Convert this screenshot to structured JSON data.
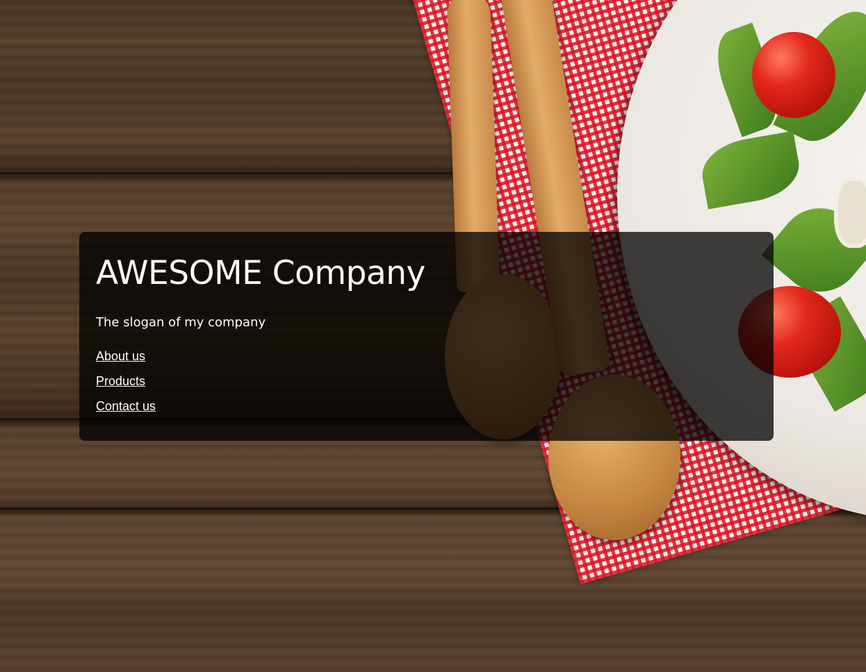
{
  "hero": {
    "title": "AWESOME Company",
    "slogan": "The slogan of my company"
  },
  "nav": {
    "items": [
      {
        "label": "About us"
      },
      {
        "label": "Products"
      },
      {
        "label": "Contact us"
      }
    ]
  },
  "colors": {
    "panel_background": "#000000",
    "text": "#ffffff"
  }
}
